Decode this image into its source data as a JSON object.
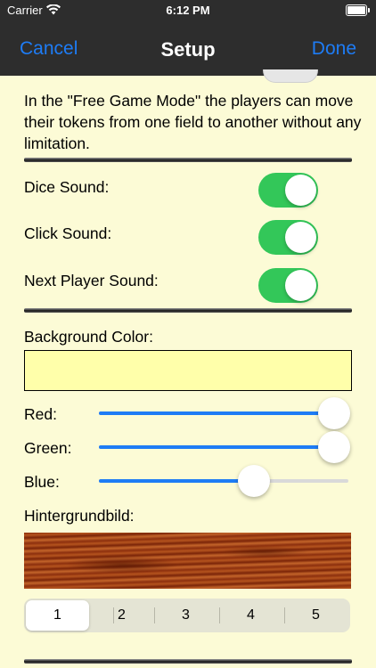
{
  "status_bar": {
    "carrier": "Carrier",
    "time": "6:12 PM"
  },
  "nav": {
    "cancel": "Cancel",
    "title": "Setup",
    "done": "Done"
  },
  "free_mode_text": "In the \"Free Game Mode\" the players can move their tokens from one field to another without any limitation.",
  "sound_settings": [
    {
      "label": "Dice Sound:",
      "on": true
    },
    {
      "label": "Click Sound:",
      "on": true
    },
    {
      "label": "Next Player Sound:",
      "on": true
    }
  ],
  "background_color": {
    "label": "Background Color:",
    "preview_hex": "#ffffaa"
  },
  "sliders": [
    {
      "label": "Red:",
      "value": 1.0
    },
    {
      "label": "Green:",
      "value": 1.0
    },
    {
      "label": "Blue:",
      "value": 0.66
    }
  ],
  "background_image": {
    "label": "Hintergrundbild:"
  },
  "segments": {
    "items": [
      "1",
      "2",
      "3",
      "4",
      "5"
    ],
    "selected": 0
  },
  "colors": {
    "nav_background": "#2d2d2d",
    "accent": "#1e7cf5",
    "switch_on": "#33c759",
    "page_background": "#fcfbd6"
  }
}
